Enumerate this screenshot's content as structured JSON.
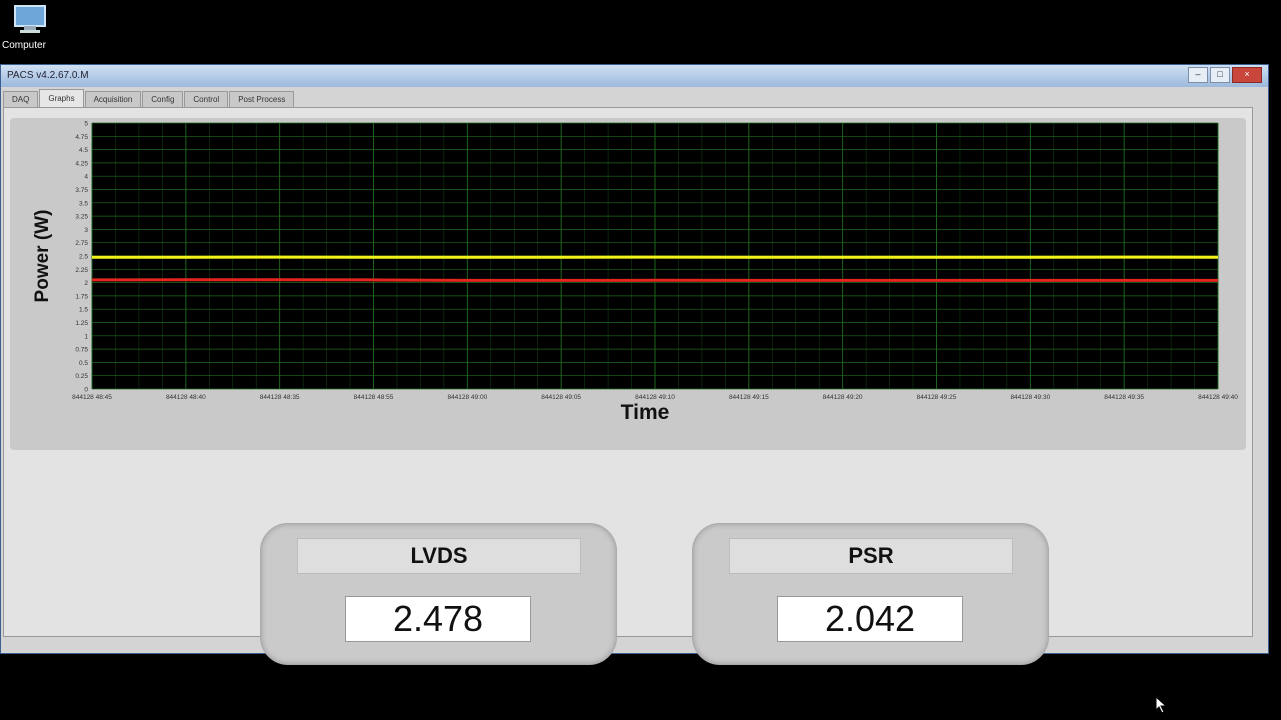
{
  "desktop": {
    "icon_label": "Computer"
  },
  "window": {
    "title": "PACS v4.2.67.0.M"
  },
  "tabs": [
    {
      "label": "DAQ",
      "active": false
    },
    {
      "label": "Graphs",
      "active": true
    },
    {
      "label": "Acquisition",
      "active": false
    },
    {
      "label": "Config",
      "active": false
    },
    {
      "label": "Control",
      "active": false
    },
    {
      "label": "Post Process",
      "active": false
    }
  ],
  "chart_data": {
    "type": "line",
    "xlabel": "Time",
    "ylabel": "Power (W)",
    "ylim": [
      0,
      5
    ],
    "yticks": [
      "0",
      "0.25",
      "0.5",
      "0.75",
      "1",
      "1.25",
      "1.5",
      "1.75",
      "2",
      "2.25",
      "2.5",
      "2.75",
      "3",
      "3.25",
      "3.5",
      "3.75",
      "4",
      "4.25",
      "4.5",
      "4.75",
      "5"
    ],
    "xticks": [
      "844128 48:45",
      "844128 48:40",
      "844128 48:35",
      "844128 48:55",
      "844128 49:00",
      "844128 49:05",
      "844128 49:10",
      "844128 49:15",
      "844128 49:20",
      "844128 49:25",
      "844128 49:30",
      "844128 49:35",
      "844128 49:40"
    ],
    "grid": true,
    "series": [
      {
        "values": [
          2.478,
          2.478,
          2.48,
          2.478,
          2.476,
          2.478,
          2.479,
          2.478,
          2.477,
          2.478,
          2.478,
          2.479,
          2.478
        ],
        "color": "#f2f21a"
      },
      {
        "values": [
          2.05,
          2.052,
          2.055,
          2.05,
          2.042,
          2.042,
          2.043,
          2.042,
          2.042,
          2.041,
          2.042,
          2.042,
          2.042
        ],
        "color": "#e4261e"
      }
    ],
    "plot_bg": "#000000",
    "grid_color": "#1f6b1f"
  },
  "readouts": {
    "lvds": {
      "label": "LVDS",
      "value": "2.478"
    },
    "psr": {
      "label": "PSR",
      "value": "2.042"
    }
  }
}
